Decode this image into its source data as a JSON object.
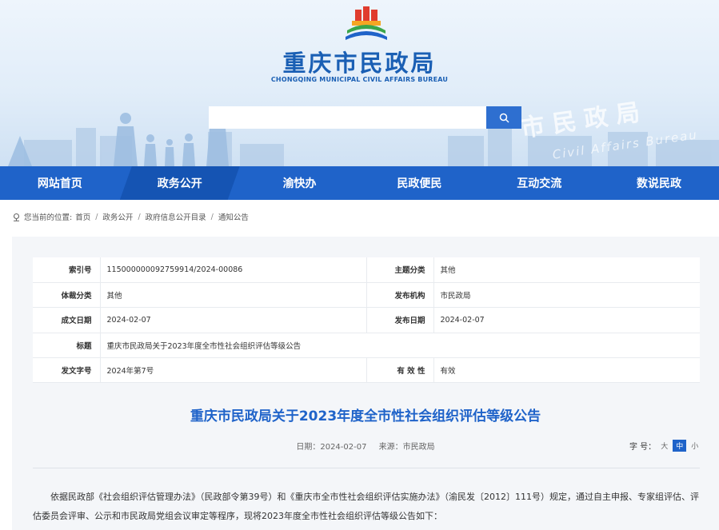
{
  "header": {
    "site_title": "重庆市民政局",
    "site_subtitle": "CHONGQING MUNICIPAL CIVIL AFFAIRS BUREAU",
    "watermark_cn": "市民政局",
    "watermark_en": "Civil Affairs Bureau",
    "search": {
      "placeholder": ""
    }
  },
  "nav": {
    "items": [
      {
        "label": "网站首页"
      },
      {
        "label": "政务公开"
      },
      {
        "label": "渝快办"
      },
      {
        "label": "民政便民"
      },
      {
        "label": "互动交流"
      },
      {
        "label": "数说民政"
      }
    ]
  },
  "breadcrumb": {
    "prefix": "您当前的位置:",
    "items": [
      "首页",
      "政务公开",
      "政府信息公开目录",
      "通知公告"
    ],
    "separator": "/"
  },
  "meta": {
    "rows": [
      {
        "k1": "索引号",
        "v1": "11500000009275991​4/2024-00086",
        "k2": "主题分类",
        "v2": "其他"
      },
      {
        "k1": "体裁分类",
        "v1": "其他",
        "k2": "发布机构",
        "v2": "市民政局"
      },
      {
        "k1": "成文日期",
        "v1": "2024-02-07",
        "k2": "发布日期",
        "v2": "2024-02-07"
      },
      {
        "k1": "标题",
        "v1": "重庆市民政局关于2023年度全市性社会组织评估等级公告",
        "k2": "",
        "v2": ""
      },
      {
        "k1": "发文字号",
        "v1": "2024年第7号",
        "k2": "有 效 性",
        "v2": "有效"
      }
    ]
  },
  "article": {
    "title": "重庆市民政局关于2023年度全市性社会组织评估等级公告",
    "date": "日期：2024-02-07",
    "source": "来源：市民政局",
    "font_size_label": "字 号：",
    "font_sizes": [
      "大",
      "中",
      "小"
    ],
    "body": "依据民政部《社会组织评估管理办法》（民政部令第39号）和《重庆市全市性社会组织评估实施办法》（渝民发〔2012〕111号）规定，通过自主申报、专家组评估、评估委员会评审、公示和市民政局党组会议审定等程序，现将2023年度全市性社会组织评估等级公告如下："
  },
  "colors": {
    "primary": "#1f63c9",
    "nav_active": "#1554b3"
  }
}
